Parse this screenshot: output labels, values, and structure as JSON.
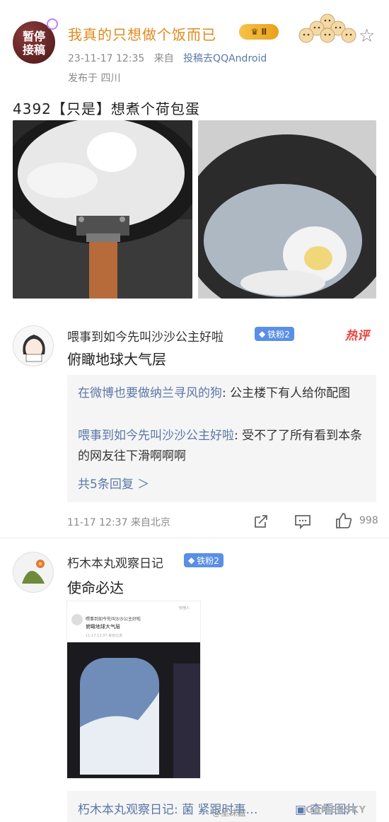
{
  "post": {
    "avatar_text_line1": "暂停",
    "avatar_text_line2": "接稿",
    "username": "我真的只想做个饭而已",
    "vip_level": "Ⅱ",
    "time": "23-11-17 12:35",
    "from_prefix": "来自",
    "source": "投稿去QQAndroid",
    "location": "发布于 四川",
    "text": "4392【只是】想煮个荷包蛋",
    "star_icon": "star-outline-icon"
  },
  "comments": [
    {
      "username": "喂事到如今先叫沙沙公主好啦",
      "fan_badge": "铁粉2",
      "hot_tag": "热评",
      "body": "俯瞰地球大气层",
      "replies": [
        {
          "name": "在微博也要做纳兰寻风的狗",
          "text": ": 公主楼下有人给你配图"
        },
        {
          "name": "喂事到如今先叫沙沙公主好啦",
          "text": ": 受不了了所有看到本条的网友往下滑啊啊啊"
        }
      ],
      "more_replies": "共5条回复 ＞",
      "time": "11-17 12:37",
      "from": "来自北京",
      "like_count": "998"
    },
    {
      "username": "朽木本丸观察日记",
      "fan_badge": "铁粉2",
      "body": "使命必达",
      "shot": {
        "top_label": "仅他人",
        "inner_username": "喂事到如今先叫沙沙公主好啦",
        "inner_body": "俯瞰地球大气层",
        "inner_meta": "11-17 12:37 来自北京"
      },
      "reply_preview": "朽木本丸观察日记: 菌 紧跟时事…",
      "view_image": "查看图片"
    }
  ],
  "watermark": "GAMERSKY",
  "weibo_mark": "@星沫盛"
}
